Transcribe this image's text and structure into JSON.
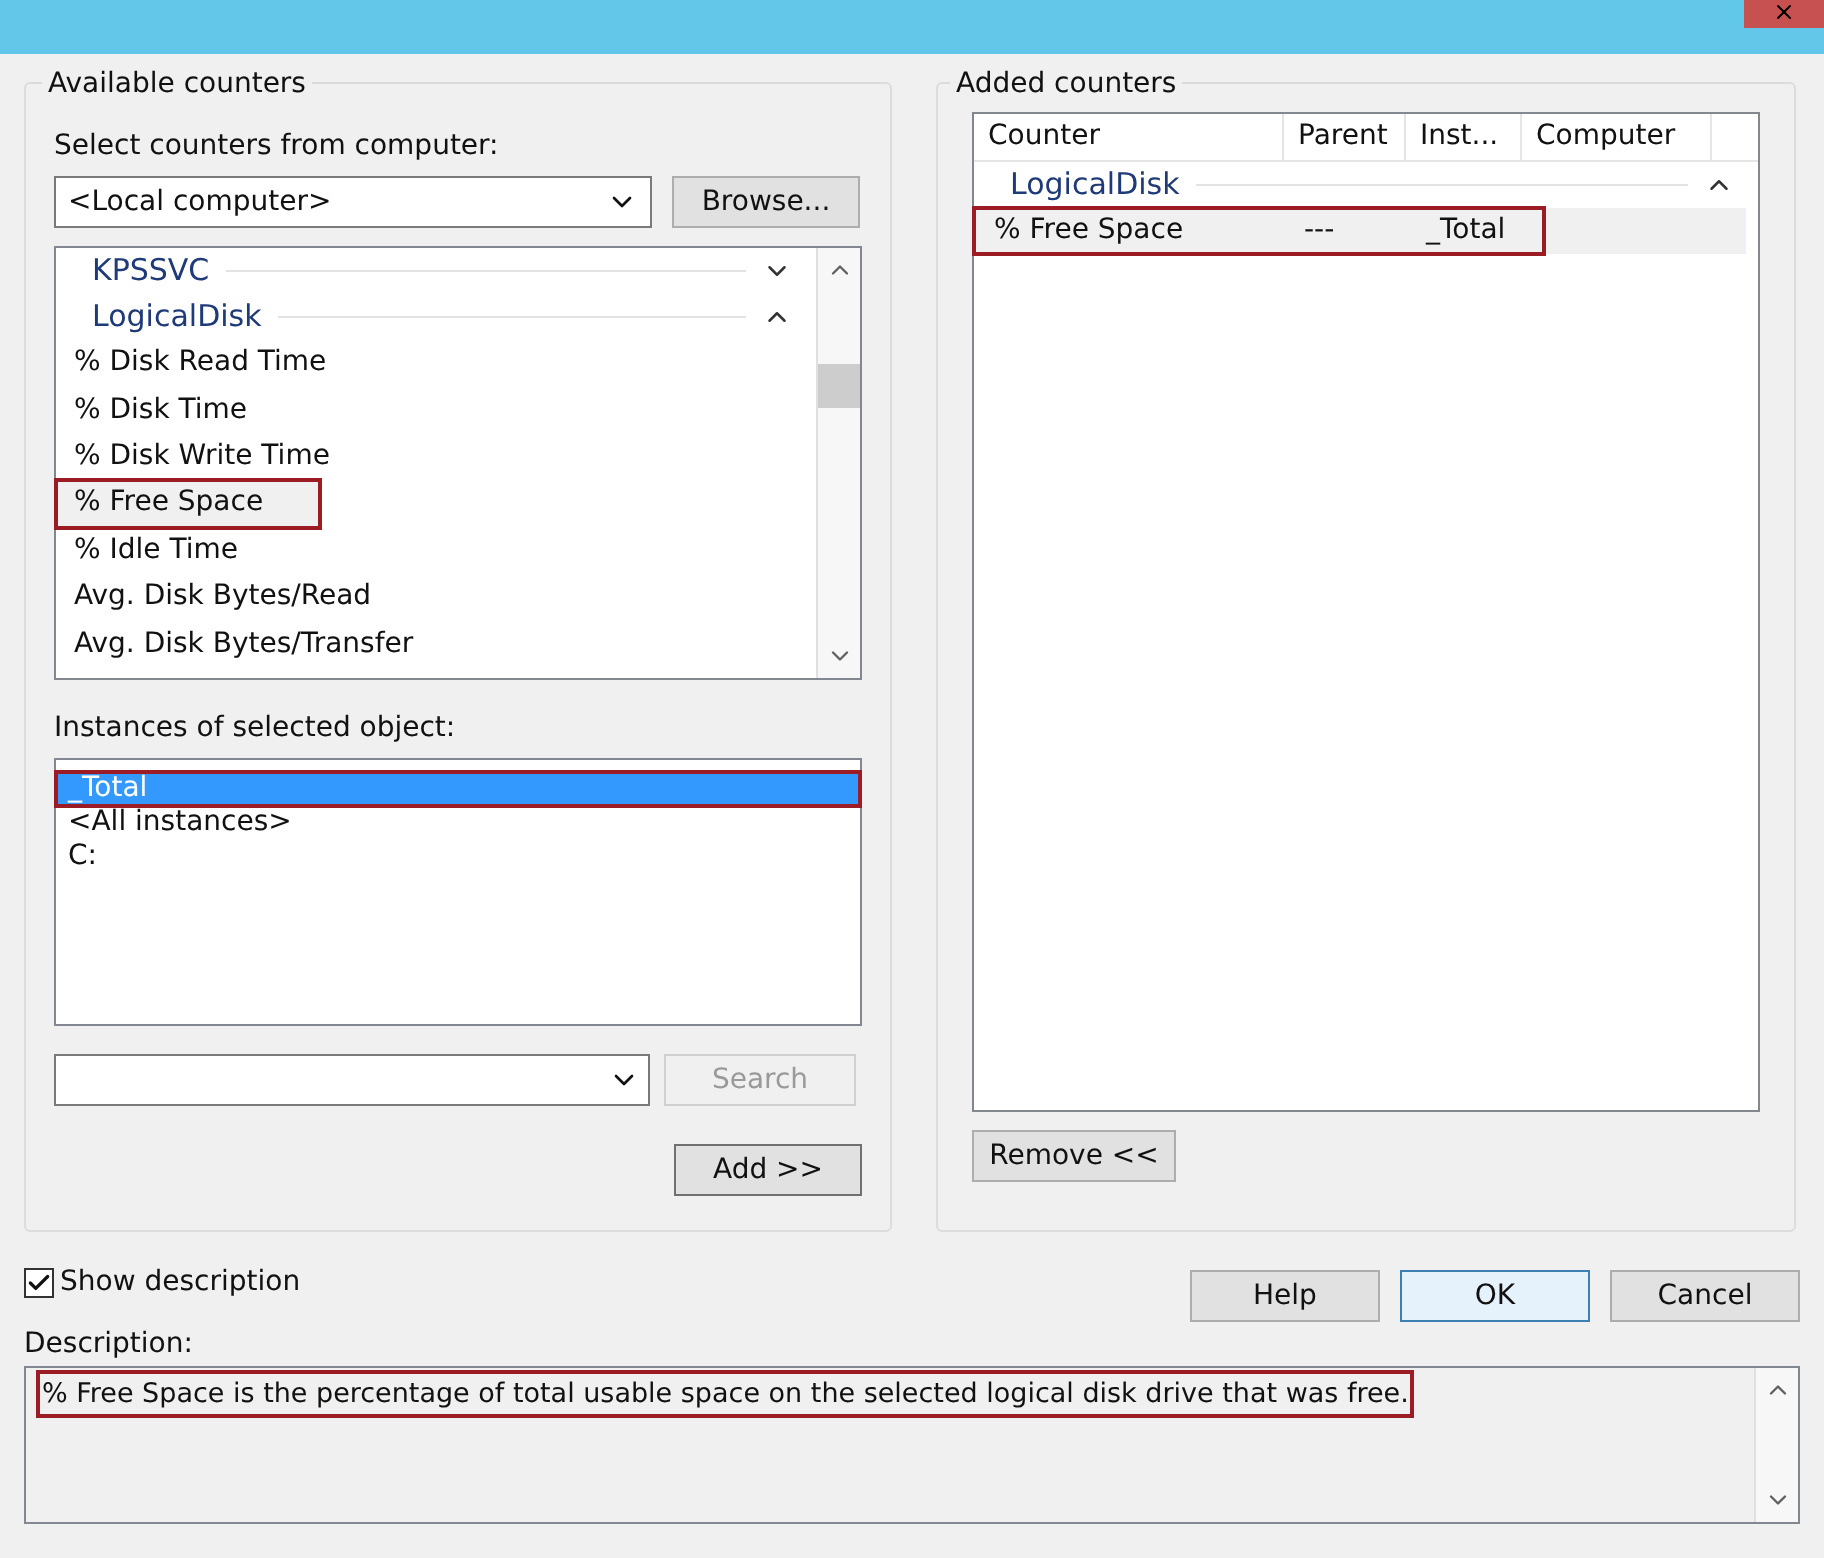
{
  "available": {
    "title": "Available counters",
    "computer_label": "Select counters from computer:",
    "computer_value": "<Local computer>",
    "browse": "Browse...",
    "counters": [
      {
        "kind": "group",
        "label": "KPSSVC",
        "expanded": false
      },
      {
        "kind": "group",
        "label": "LogicalDisk",
        "expanded": true
      },
      {
        "kind": "counter",
        "label": "% Disk Read Time",
        "selected": false,
        "highlighted": false
      },
      {
        "kind": "counter",
        "label": "% Disk Time",
        "selected": false,
        "highlighted": false
      },
      {
        "kind": "counter",
        "label": "% Disk Write Time",
        "selected": false,
        "highlighted": false
      },
      {
        "kind": "counter",
        "label": "% Free Space",
        "selected": true,
        "highlighted": true
      },
      {
        "kind": "counter",
        "label": "% Idle Time",
        "selected": false,
        "highlighted": false
      },
      {
        "kind": "counter",
        "label": "Avg. Disk Bytes/Read",
        "selected": false,
        "highlighted": false
      },
      {
        "kind": "counter",
        "label": "Avg. Disk Bytes/Transfer",
        "selected": false,
        "highlighted": false
      }
    ],
    "instances_label": "Instances of selected object:",
    "instances": [
      {
        "label": "_Total",
        "selected": true,
        "highlighted": true
      },
      {
        "label": "<All instances>",
        "selected": false,
        "highlighted": false
      },
      {
        "label": "C:",
        "selected": false,
        "highlighted": false
      }
    ],
    "search": {
      "label": "Search",
      "disabled": true
    },
    "add": "Add >>"
  },
  "added": {
    "title": "Added counters",
    "columns": [
      "Counter",
      "Parent",
      "Inst...",
      "Computer"
    ],
    "groups": [
      {
        "label": "LogicalDisk",
        "expanded": true,
        "rows": [
          {
            "cells": [
              "% Free Space",
              "---",
              "_Total"
            ],
            "highlighted": true
          }
        ]
      }
    ],
    "remove": "Remove <<"
  },
  "show_description": {
    "label": "Show description",
    "checked": true
  },
  "buttons": [
    {
      "label": "Help",
      "default": false
    },
    {
      "label": "OK",
      "default": true
    },
    {
      "label": "Cancel",
      "default": false
    }
  ],
  "description": {
    "label": "Description:",
    "text": "% Free Space is the percentage of total usable space on the selected logical disk drive that was free.",
    "highlighted": true
  }
}
